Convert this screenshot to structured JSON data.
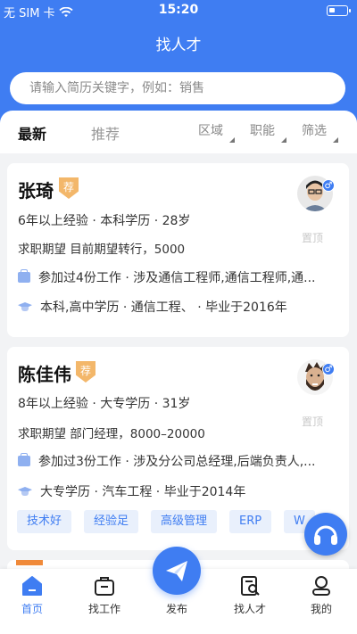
{
  "status": {
    "carrier": "无 SIM 卡",
    "time": "15:20"
  },
  "header": {
    "title": "找人才"
  },
  "search": {
    "placeholder": "请输入简历关键字，例如：销售"
  },
  "tabs": {
    "latest": "最新",
    "recommended": "推荐"
  },
  "filters": {
    "area": "区域",
    "position": "职能",
    "filter": "筛选"
  },
  "candidates": [
    {
      "name": "张琦",
      "badge": "荐",
      "summary": "6年以上经验 · 本科学历 · 28岁",
      "expectation": "求职期望 目前期望转行，5000",
      "work": "参加过4份工作 · 涉及通信工程师,通信工程师,通...",
      "education": "本科,高中学历 · 通信工程、 · 毕业于2016年",
      "top_label": "置顶",
      "gender": "♂",
      "tags": []
    },
    {
      "name": "陈佳伟",
      "badge": "荐",
      "summary": "8年以上经验 · 大专学历 · 31岁",
      "expectation": "求职期望 部门经理，8000–20000",
      "work": "参加过3份工作 · 涉及分公司总经理,后端负责人,...",
      "education": "大专学历 · 汽车工程 · 毕业于2014年",
      "top_label": "置顶",
      "gender": "♂",
      "tags": [
        "技术好",
        "经验足",
        "高级管理",
        "ERP",
        "W"
      ]
    }
  ],
  "bottom_nav": {
    "home": "首页",
    "find_job": "找工作",
    "publish": "发布",
    "find_talent": "找人才",
    "mine": "我的"
  },
  "colors": {
    "primary": "#3f7df2",
    "badge": "#f3b76a",
    "tag_bg": "#e9f0fc"
  }
}
